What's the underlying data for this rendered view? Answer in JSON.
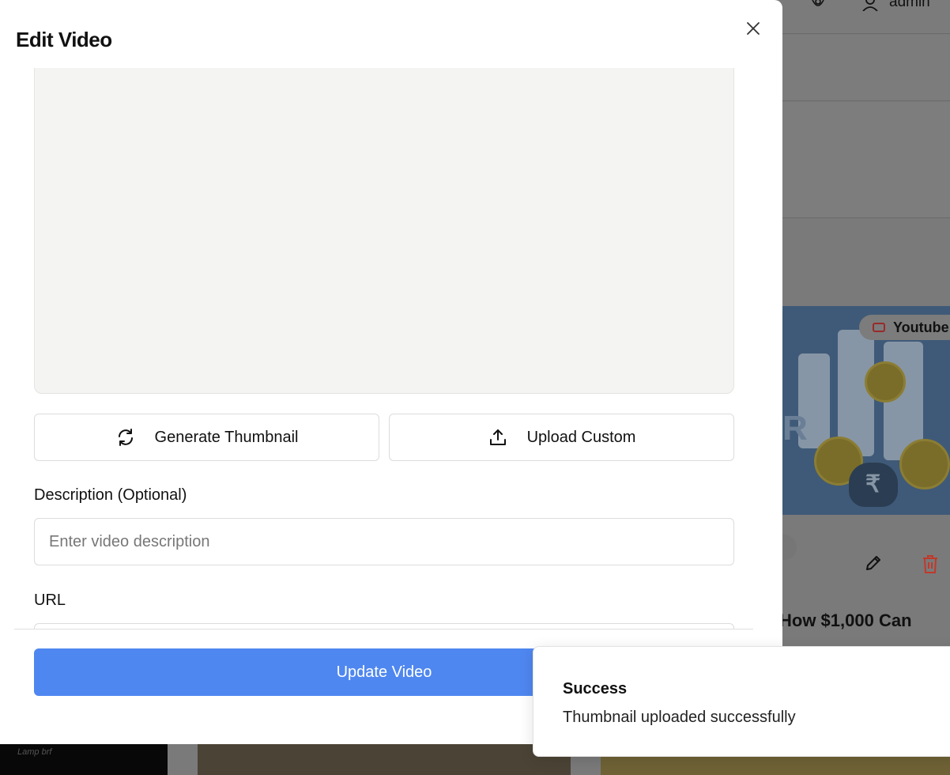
{
  "background": {
    "topbar": {
      "user_label": "admin",
      "icons": [
        "settings-gear-icon",
        "user-icon"
      ]
    },
    "video_card": {
      "platform_badge": "Youtube",
      "platform_icon": "youtube-icon",
      "title_fragment": "ct: How $1,000 Can",
      "faint_pill": "s",
      "actions": [
        "edit-pencil-icon",
        "delete-trash-icon"
      ]
    },
    "bottom_caption": "Lamp brf"
  },
  "modal": {
    "title": "Edit Video",
    "close_icon": "close-icon",
    "buttons": {
      "generate_thumbnail": {
        "label": "Generate Thumbnail",
        "icon": "refresh-icon"
      },
      "upload_custom": {
        "label": "Upload Custom",
        "icon": "upload-icon"
      }
    },
    "fields": {
      "description": {
        "label": "Description (Optional)",
        "value": "",
        "placeholder": "Enter video description"
      },
      "url": {
        "label": "URL",
        "value": ""
      }
    },
    "submit_label": "Update Video"
  },
  "toast": {
    "title": "Success",
    "message": "Thumbnail uploaded successfully"
  },
  "colors": {
    "primary_button": "#4f87f0",
    "overlay": "#7a7a7a",
    "preview_bg": "#f4f4f2",
    "delete_red": "#c0392b"
  }
}
